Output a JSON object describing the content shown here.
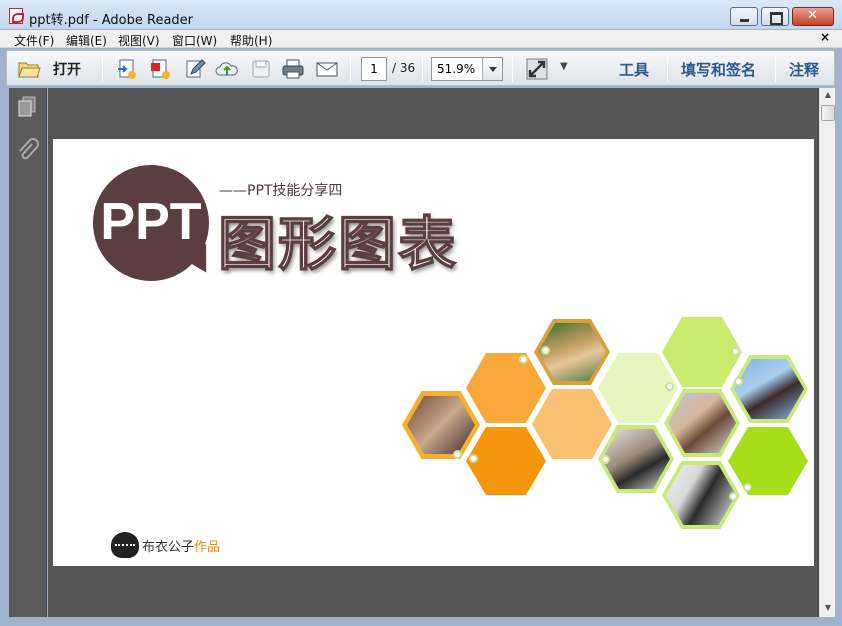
{
  "window": {
    "title": "ppt转.pdf - Adobe Reader"
  },
  "menubar": {
    "items": [
      "文件(F)",
      "编辑(E)",
      "视图(V)",
      "窗口(W)",
      "帮助(H)"
    ],
    "close_glyph": "×"
  },
  "toolbar": {
    "open_label": "打开",
    "page_current": "1",
    "page_total": "/ 36",
    "zoom": "51.9%",
    "panels": [
      "工具",
      "填写和签名",
      "注释"
    ],
    "icons": [
      "open-folder-icon",
      "create-pdf-icon",
      "export-pdf-icon",
      "edit-icon",
      "upload-cloud-icon",
      "save-icon",
      "print-icon",
      "email-icon",
      "fullscreen-icon"
    ]
  },
  "document": {
    "bubble_text": "PPT",
    "subtitle": "——PPT技能分享四",
    "title": "图形图表",
    "logo_text": "布衣公子",
    "logo_accent": "作品"
  },
  "colors": {
    "bubble": "#5a3e40",
    "orange": "#f39a1e",
    "light_orange": "#fbbd6b",
    "lime": "#c9ec6e",
    "pale_lime": "#e3f5bb",
    "green": "#a6de1a",
    "panel_text": "#2d5a8a"
  }
}
